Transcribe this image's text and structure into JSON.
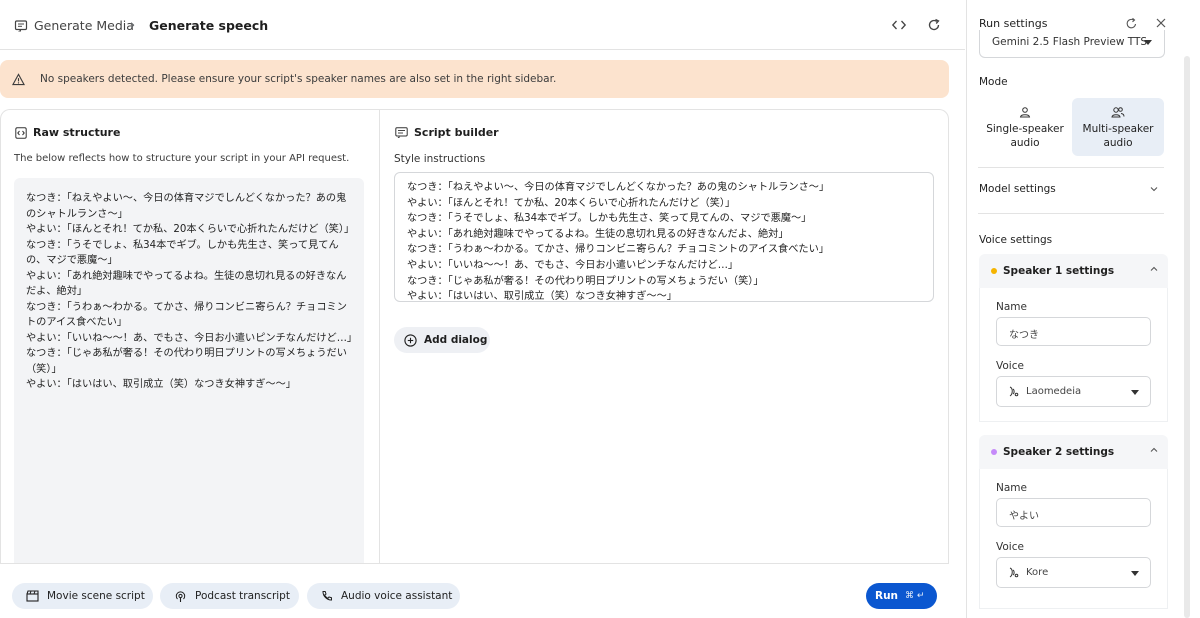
{
  "header": {
    "breadcrumb_root": "Generate Media",
    "breadcrumb_separator": "›",
    "breadcrumb_current": "Generate speech"
  },
  "warning": {
    "text": "No speakers detected. Please ensure your script's speaker names are also set in the right sidebar."
  },
  "raw_structure": {
    "title": "Raw structure",
    "description": "The below reflects how to structure your script in your API request.",
    "lines": [
      "なつき：「ねえやよい〜、今日の体育マジでしんどくなかった？あの鬼のシャトルランさ〜」",
      "やよい：「ほんとそれ！てか私、20本くらいで心折れたんだけど（笑）」",
      "なつき：「うそでしょ、私34本でギブ。しかも先生さ、笑って見てんの、マジで悪魔〜」",
      "やよい：「あれ絶対趣味でやってるよね。生徒の息切れ見るの好きなんだよ、絶対」",
      "なつき：「うわぁ〜わかる。てかさ、帰りコンビニ寄らん？チョコミントのアイス食べたい」",
      "やよい：「いいね〜〜！あ、でもさ、今日お小遣いピンチなんだけど…」",
      "なつき：「じゃあ私が奢る！その代わり明日プリントの写メちょうだい（笑）」",
      "やよい：「はいはい、取引成立（笑）なつき女神すぎ〜〜」"
    ]
  },
  "script_builder": {
    "title": "Script builder",
    "style_label": "Style instructions",
    "style_lines": [
      "なつき：「ねえやよい〜、今日の体育マジでしんどくなかった？あの鬼のシャトルランさ〜」",
      "やよい：「ほんとそれ！てか私、20本くらいで心折れたんだけど（笑）」",
      "なつき：「うそでしょ、私34本でギブ。しかも先生さ、笑って見てんの、マジで悪魔〜」",
      "やよい：「あれ絶対趣味でやってるよね。生徒の息切れ見るの好きなんだよ、絶対」",
      "なつき：「うわぁ〜わかる。てかさ、帰りコンビニ寄らん？チョコミントのアイス食べたい」",
      "やよい：「いいね〜〜！あ、でもさ、今日お小遣いピンチなんだけど…」",
      "なつき：「じゃあ私が奢る！その代わり明日プリントの写メちょうだい（笑）」",
      "やよい：「はいはい、取引成立（笑）なつき女神すぎ〜〜」"
    ],
    "add_dialog": "Add dialog"
  },
  "bottom": {
    "chips": [
      "Movie scene script",
      "Podcast transcript",
      "Audio voice assistant"
    ],
    "run_label": "Run",
    "run_shortcut": "⌘ ↵"
  },
  "sidebar": {
    "title": "Run settings",
    "model": "Gemini 2.5 Flash Preview TTS",
    "mode_label": "Mode",
    "mode_single": "Single-speaker audio",
    "mode_multi": "Multi-speaker audio",
    "model_settings": "Model settings",
    "voice_settings": "Voice settings",
    "speaker1": {
      "title": "Speaker 1 settings",
      "name_label": "Name",
      "name_value": "なつき",
      "voice_label": "Voice",
      "voice_value": "Laomedeia",
      "dot_color": "#f5b400"
    },
    "speaker2": {
      "title": "Speaker 2 settings",
      "name_label": "Name",
      "name_value": "やよい",
      "voice_label": "Voice",
      "voice_value": "Kore",
      "dot_color": "#c58af9"
    }
  },
  "colors": {
    "warning_bg": "#fce3ce",
    "run_button": "#0b57d0",
    "chip_bg": "#e8eef6"
  }
}
